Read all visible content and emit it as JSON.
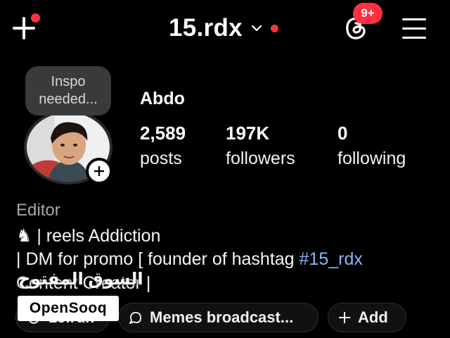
{
  "header": {
    "username": "15.rdx",
    "notification_badge": "9+",
    "icons": [
      "plus-icon",
      "chevron-down-icon",
      "threads-icon",
      "hamburger-menu-icon"
    ],
    "accent_color": "#ff3040"
  },
  "profile": {
    "note_line1": "Inspo",
    "note_line2": "needed...",
    "display_name": "Abdo",
    "stats": [
      {
        "value": "2,589",
        "label": "posts"
      },
      {
        "value": "197K",
        "label": "followers"
      },
      {
        "value": "0",
        "label": "following"
      }
    ]
  },
  "bio": {
    "category": "Editor",
    "line1": "♞ | reels Addiction",
    "line2_text": "| DM for promo [ founder of hashtag ",
    "line2_hashtag": "#15_rdx",
    "line3": "Content Creator |",
    "hashtag_color": "#8ab4f8"
  },
  "chips": {
    "threads_handle": "15.rdx",
    "broadcast": "Memes broadcast...",
    "add": "Add"
  },
  "watermark": {
    "arabic": "السوق المفتوح",
    "brand": "OpenSooq"
  }
}
